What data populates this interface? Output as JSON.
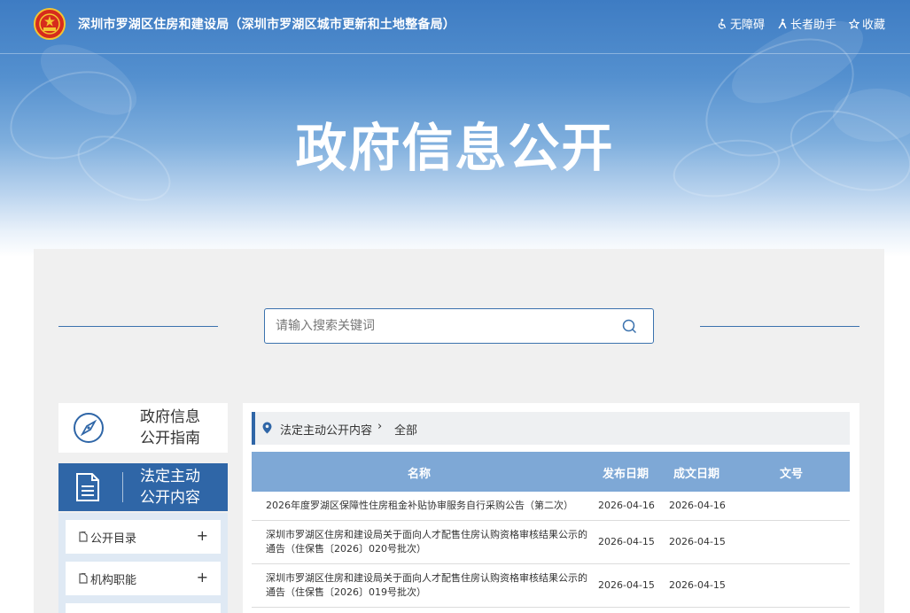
{
  "header": {
    "site_title": "深圳市罗湖区住房和建设局（深圳市罗湖区城市更新和土地整备局）",
    "links": [
      {
        "label": "无障碍",
        "icon": "accessibility-icon"
      },
      {
        "label": "长者助手",
        "icon": "elder-assist-icon"
      },
      {
        "label": "收藏",
        "icon": "star-icon"
      }
    ]
  },
  "hero": {
    "title": "政府信息公开"
  },
  "search": {
    "placeholder": "请输入搜索关键词"
  },
  "sidebar": {
    "guide": {
      "line1": "政府信息",
      "line2": "公开指南",
      "icon": "compass-icon"
    },
    "active": {
      "line1": "法定主动",
      "line2": "公开内容",
      "icon": "document-icon"
    },
    "items": [
      {
        "label": "公开目录",
        "toggle": "+"
      },
      {
        "label": "机构职能",
        "toggle": "+"
      }
    ]
  },
  "breadcrumb": {
    "level1": "法定主动公开内容",
    "separator": "›",
    "level2": "全部"
  },
  "table": {
    "headers": {
      "name": "名称",
      "published": "发布日期",
      "created": "成文日期",
      "doc_no": "文号"
    },
    "rows": [
      {
        "name": "2026年度罗湖区保障性住房租金补贴协审服务自行采购公告（第二次）",
        "published": "2026-04-16",
        "created": "2026-04-16",
        "doc_no": ""
      },
      {
        "name": "深圳市罗湖区住房和建设局关于面向人才配售住房认购资格审核结果公示的通告（住保售〔2026〕020号批次）",
        "published": "2026-04-15",
        "created": "2026-04-15",
        "doc_no": ""
      },
      {
        "name": "深圳市罗湖区住房和建设局关于面向人才配售住房认购资格审核结果公示的通告（住保售〔2026〕019号批次）",
        "published": "2026-04-15",
        "created": "2026-04-15",
        "doc_no": ""
      }
    ]
  },
  "colors": {
    "primary": "#2f66a7",
    "table_header": "#7ea8d6",
    "panel_bg": "#f0f0f0",
    "banner": "#3e7cc3"
  }
}
